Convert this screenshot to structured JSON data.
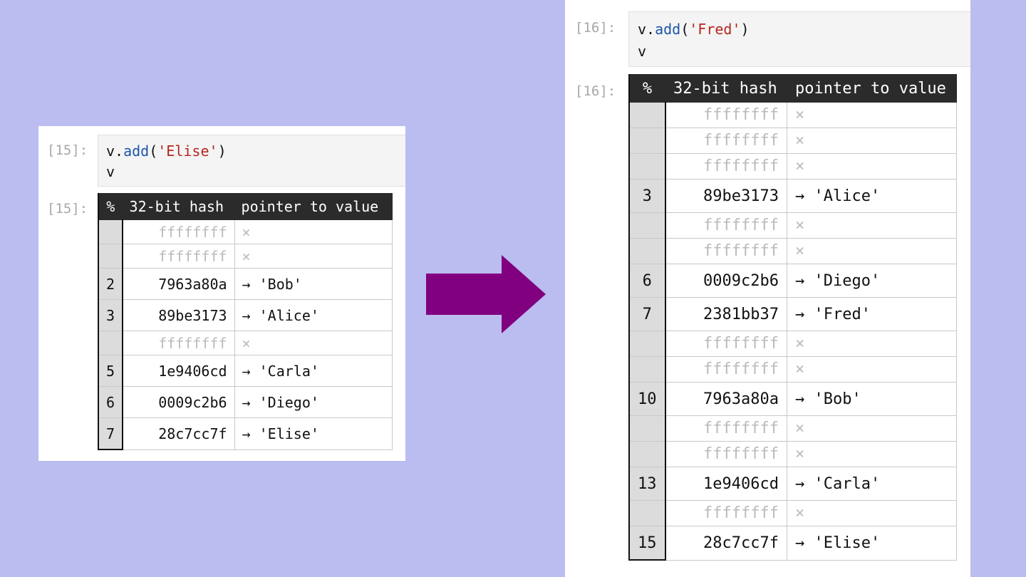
{
  "colors": {
    "background": "#bbbcf0",
    "arrow": "#800080",
    "string": "#b5261e",
    "method": "#1e56a8"
  },
  "left": {
    "input_prompt": "[15]:",
    "output_prompt": "[15]:",
    "code": {
      "obj": "v",
      "method": "add",
      "arg": "'Elise'",
      "line2": "v"
    },
    "headers": {
      "idx": "%",
      "hash": "32-bit hash",
      "ptr": "pointer to value"
    },
    "rows": [
      {
        "idx": "",
        "hash": "ffffffff",
        "ptr": "×",
        "empty": true
      },
      {
        "idx": "",
        "hash": "ffffffff",
        "ptr": "×",
        "empty": true
      },
      {
        "idx": "2",
        "hash": "7963a80a",
        "ptr": "→ 'Bob'",
        "empty": false
      },
      {
        "idx": "3",
        "hash": "89be3173",
        "ptr": "→ 'Alice'",
        "empty": false
      },
      {
        "idx": "",
        "hash": "ffffffff",
        "ptr": "×",
        "empty": true
      },
      {
        "idx": "5",
        "hash": "1e9406cd",
        "ptr": "→ 'Carla'",
        "empty": false
      },
      {
        "idx": "6",
        "hash": "0009c2b6",
        "ptr": "→ 'Diego'",
        "empty": false
      },
      {
        "idx": "7",
        "hash": "28c7cc7f",
        "ptr": "→ 'Elise'",
        "empty": false
      }
    ]
  },
  "right": {
    "input_prompt": "[16]:",
    "output_prompt": "[16]:",
    "code": {
      "obj": "v",
      "method": "add",
      "arg": "'Fred'",
      "line2": "v"
    },
    "headers": {
      "idx": "%",
      "hash": "32-bit hash",
      "ptr": "pointer to value"
    },
    "rows": [
      {
        "idx": "",
        "hash": "ffffffff",
        "ptr": "×",
        "empty": true
      },
      {
        "idx": "",
        "hash": "ffffffff",
        "ptr": "×",
        "empty": true
      },
      {
        "idx": "",
        "hash": "ffffffff",
        "ptr": "×",
        "empty": true
      },
      {
        "idx": "3",
        "hash": "89be3173",
        "ptr": "→ 'Alice'",
        "empty": false
      },
      {
        "idx": "",
        "hash": "ffffffff",
        "ptr": "×",
        "empty": true
      },
      {
        "idx": "",
        "hash": "ffffffff",
        "ptr": "×",
        "empty": true
      },
      {
        "idx": "6",
        "hash": "0009c2b6",
        "ptr": "→ 'Diego'",
        "empty": false
      },
      {
        "idx": "7",
        "hash": "2381bb37",
        "ptr": "→ 'Fred'",
        "empty": false
      },
      {
        "idx": "",
        "hash": "ffffffff",
        "ptr": "×",
        "empty": true
      },
      {
        "idx": "",
        "hash": "ffffffff",
        "ptr": "×",
        "empty": true
      },
      {
        "idx": "10",
        "hash": "7963a80a",
        "ptr": "→ 'Bob'",
        "empty": false
      },
      {
        "idx": "",
        "hash": "ffffffff",
        "ptr": "×",
        "empty": true
      },
      {
        "idx": "",
        "hash": "ffffffff",
        "ptr": "×",
        "empty": true
      },
      {
        "idx": "13",
        "hash": "1e9406cd",
        "ptr": "→ 'Carla'",
        "empty": false
      },
      {
        "idx": "",
        "hash": "ffffffff",
        "ptr": "×",
        "empty": true
      },
      {
        "idx": "15",
        "hash": "28c7cc7f",
        "ptr": "→ 'Elise'",
        "empty": false
      }
    ]
  }
}
